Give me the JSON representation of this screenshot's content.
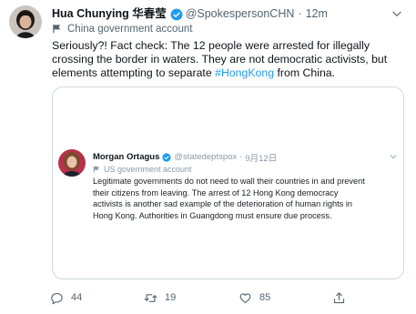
{
  "tweet": {
    "author_name": "Hua Chunying 华春莹",
    "handle": "@SpokespersonCHN",
    "separator": "·",
    "time": "12m",
    "account_label": "China government account",
    "text_lines": [
      "Seriously?! Fact check: The 12 people were arrested for illegally",
      "crossing the border in waters. They are not democratic activists, but",
      "elements attempting to separate"
    ],
    "hashtag": "#HongKong",
    "text_tail": " from China.",
    "icons": {
      "verified": "verified-badge-icon",
      "flag": "government-flag-icon",
      "more": "chevron-down-icon"
    },
    "colors": {
      "link": "#1d9bf0",
      "secondary": "#536471"
    }
  },
  "quoted": {
    "author_name": "Morgan Ortagus",
    "handle": "@statedeptspox",
    "separator": "·",
    "time": "9月12日",
    "account_label": "US government account",
    "text_lines": [
      "Legitimate governments do not need to wall their countries in and prevent",
      "their citizens from leaving. The arrest of 12 Hong Kong democracy",
      "activists is another sad example of the deterioration of human rights in",
      "Hong Kong. Authorities in Guangdong must ensure due process."
    ]
  },
  "actions": {
    "reply_count": "44",
    "retweet_count": "19",
    "like_count": "85",
    "icons": [
      "reply-icon",
      "retweet-icon",
      "like-icon",
      "share-icon"
    ]
  }
}
